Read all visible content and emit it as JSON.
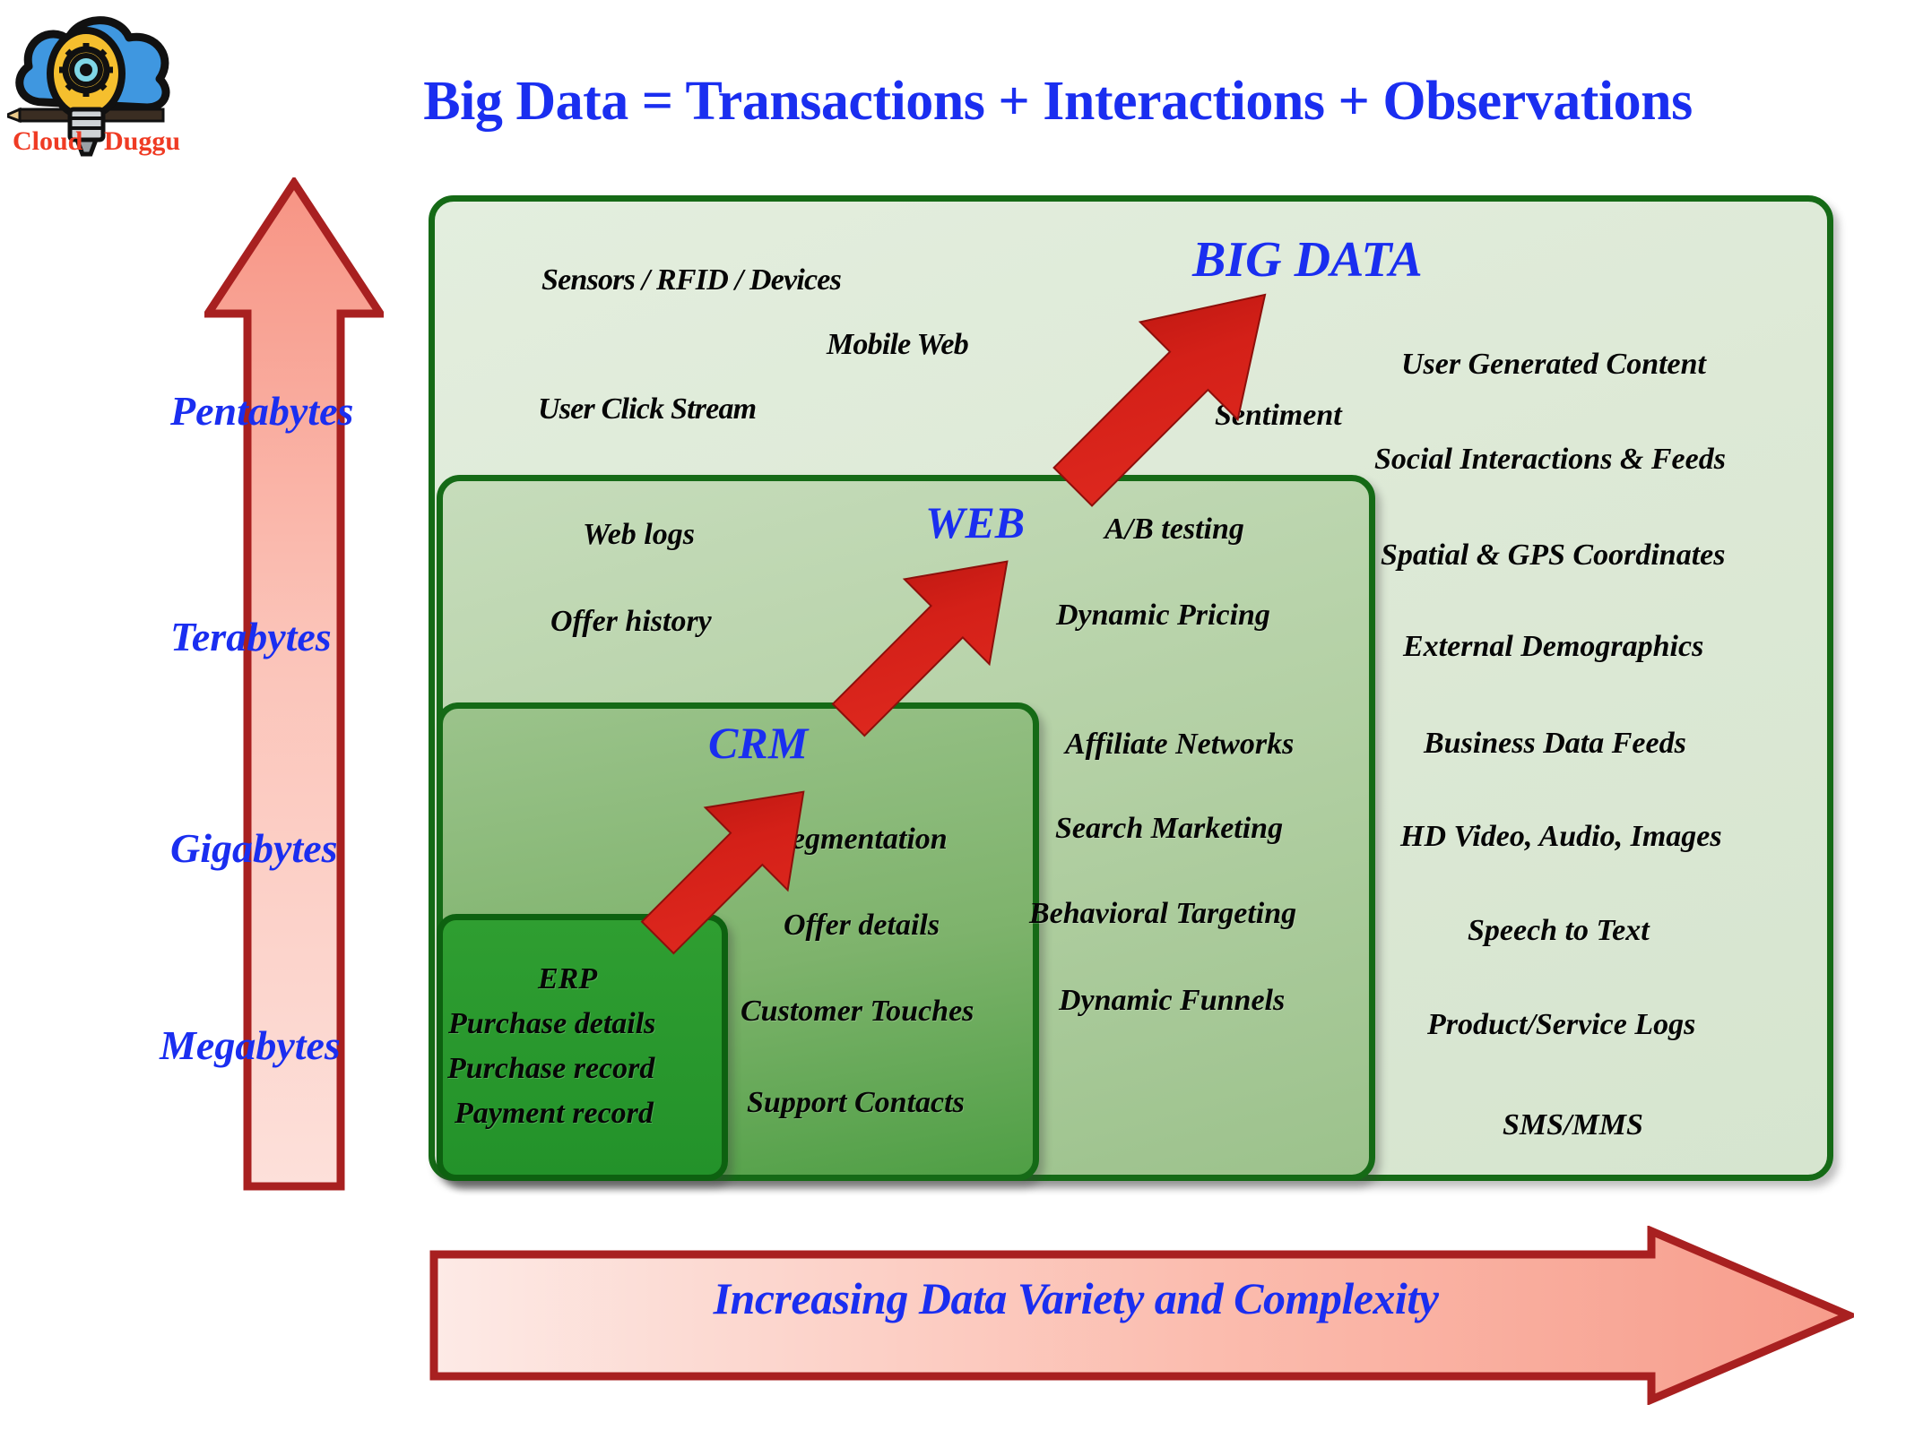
{
  "logo": {
    "brand_left": "Cloud",
    "brand_right": "Duggu",
    "icon": "cloud-lightbulb-pencil-logo"
  },
  "header": {
    "title": "Big Data = Transactions + Interactions + Observations"
  },
  "vertical_axis": {
    "icon": "up-arrow-icon",
    "labels": [
      "Pentabytes",
      "Terabytes",
      "Gigabytes",
      "Megabytes"
    ]
  },
  "bottom_axis": {
    "icon": "right-arrow-icon",
    "label": "Increasing Data Variety and Complexity"
  },
  "keywords": {
    "big_data": "BIG DATA",
    "web": "WEB",
    "crm": "CRM"
  },
  "panels": {
    "observations": {
      "name": "BIG DATA",
      "top_items": [
        "Sensors / RFID / Devices",
        "Mobile Web",
        "User Click Stream",
        "Sentiment"
      ],
      "right_items": [
        "User Generated Content",
        "Social Interactions & Feeds",
        "Spatial & GPS Coordinates",
        "External Demographics",
        "Business Data Feeds",
        "HD Video, Audio, Images",
        "Speech to Text",
        "Product/Service Logs",
        "SMS/MMS"
      ]
    },
    "web": {
      "name": "WEB",
      "left_items": [
        "Web logs",
        "Offer history"
      ],
      "right_items": [
        "A/B testing",
        "Dynamic Pricing",
        "Affiliate Networks",
        "Search Marketing",
        "Behavioral Targeting",
        "Dynamic Funnels"
      ]
    },
    "crm": {
      "name": "CRM",
      "items": [
        "Segmentation",
        "Offer details",
        "Customer Touches",
        "Support Contacts"
      ]
    },
    "erp": {
      "name": "ERP",
      "items": [
        "ERP",
        "Purchase details",
        "Purchase record",
        "Payment record"
      ]
    }
  },
  "colors": {
    "accent_blue": "#1a2ef0",
    "arrow_red": "#c01a1a",
    "arrow_pink": "#f6a79b",
    "panel_green_border": "#156a16",
    "logo_red": "#ef3b24"
  }
}
